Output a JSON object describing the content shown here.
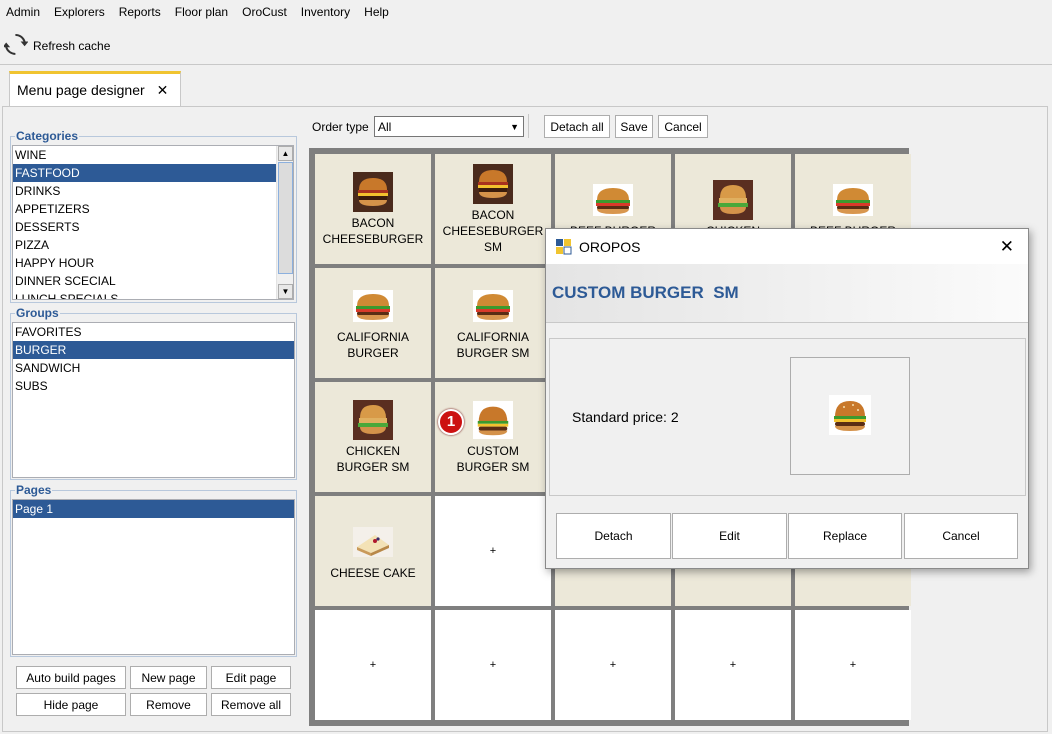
{
  "menubar": {
    "items": [
      "Admin",
      "Explorers",
      "Reports",
      "Floor plan",
      "OroCust",
      "Inventory",
      "Help"
    ]
  },
  "toolbar": {
    "refresh_label": "Refresh cache"
  },
  "tabs": [
    {
      "label": "Menu page designer",
      "close": "✕"
    }
  ],
  "categories": {
    "title": "Categories",
    "items": [
      "WINE",
      "FASTFOOD",
      "DRINKS",
      "APPETIZERS",
      "DESSERTS",
      "PIZZA",
      "HAPPY HOUR",
      "DINNER SCECIAL",
      "LUNCH SPECIALS"
    ],
    "selected": "FASTFOOD"
  },
  "groups": {
    "title": "Groups",
    "items": [
      "FAVORITES",
      "BURGER",
      "SANDWICH",
      "SUBS"
    ],
    "selected": "BURGER"
  },
  "pages": {
    "title": "Pages",
    "items": [
      "Page 1"
    ],
    "selected": "Page 1"
  },
  "page_buttons": {
    "auto_build": "Auto build pages",
    "new_page": "New page",
    "edit_page": "Edit page",
    "hide_page": "Hide page",
    "remove": "Remove",
    "remove_all": "Remove all"
  },
  "order_type": {
    "label": "Order type",
    "value": "All"
  },
  "top_buttons": {
    "detach_all": "Detach all",
    "save": "Save",
    "cancel": "Cancel"
  },
  "grid": {
    "cells": [
      {
        "label": "BACON\nCHEESEBURGER",
        "image": "bacon-cheeseburger"
      },
      {
        "label": "BACON\nCHEESEBURGER\nSM",
        "image": "bacon-cheeseburger"
      },
      {
        "label": "BEEF BURGER",
        "image": "burger"
      },
      {
        "label": "CHICKEN",
        "image": "chicken-burger"
      },
      {
        "label": "BEEF BURGER",
        "image": "burger"
      },
      {
        "label": "CALIFORNIA\nBURGER",
        "image": "burger"
      },
      {
        "label": "CALIFORNIA\nBURGER SM",
        "image": "burger"
      },
      {
        "label": "",
        "image": ""
      },
      {
        "label": "",
        "image": ""
      },
      {
        "label": "",
        "image": ""
      },
      {
        "label": "CHICKEN\nBURGER SM",
        "image": "chicken-burger"
      },
      {
        "label": "CUSTOM\nBURGER SM",
        "image": "cheeseburger"
      },
      {
        "label": "",
        "image": ""
      },
      {
        "label": "",
        "image": ""
      },
      {
        "label": "",
        "image": ""
      },
      {
        "label": "CHEESE CAKE",
        "image": "cheese-cake"
      },
      {
        "label": "+",
        "image": ""
      },
      {
        "label": "",
        "image": ""
      },
      {
        "label": "",
        "image": ""
      },
      {
        "label": "",
        "image": ""
      },
      {
        "label": "+",
        "image": ""
      },
      {
        "label": "+",
        "image": ""
      },
      {
        "label": "+",
        "image": ""
      },
      {
        "label": "+",
        "image": ""
      },
      {
        "label": "+",
        "image": ""
      }
    ],
    "badge": "1"
  },
  "dialog": {
    "title": "OROPOS",
    "close": "✕",
    "product_name": "CUSTOM BURGER  SM",
    "standard_price": "Standard price: 2",
    "buttons": {
      "detach": "Detach",
      "edit": "Edit",
      "replace": "Replace",
      "cancel": "Cancel"
    }
  },
  "colors": {
    "accent": "#2d5a96",
    "tab_highlight": "#f0c430",
    "badge": "#cc1111",
    "grid_bg": "#7f7f7f",
    "cell_bg": "#ece8d9"
  }
}
